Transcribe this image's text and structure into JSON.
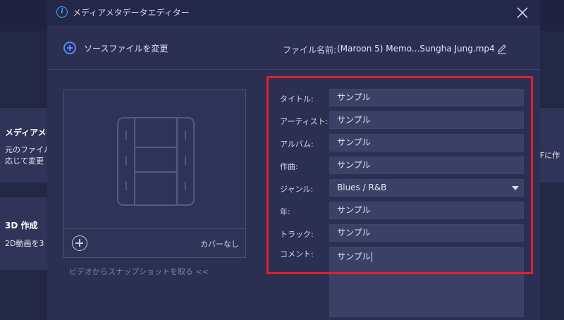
{
  "background": {
    "card1": {
      "title": "メディアメタ",
      "desc": [
        "元のファイル",
        "応じて変更"
      ]
    },
    "card2": {
      "title": "3D 作成",
      "desc": "2D動画を3"
    },
    "right_card": {
      "desc": "GIFに作"
    }
  },
  "dialog": {
    "title": "メディアメタデータエディター",
    "info_icon": "info-icon",
    "close_icon": "close-icon",
    "toolbar": {
      "change_source_label": "ソースファイルを変更",
      "filename_label": "ファイル名前:",
      "filename_value": "(Maroon 5) Memo...Sungha Jung.mp4",
      "edit_icon": "pencil-icon"
    },
    "cover": {
      "no_cover_label": "カバーなし",
      "snapshot_link": "ビデオからスナップショットを取る <<"
    },
    "form": {
      "title": {
        "label": "タイトル:",
        "value": "サンプル"
      },
      "artist": {
        "label": "アーティスト:",
        "value": "サンプル"
      },
      "album": {
        "label": "アルバム:",
        "value": "サンプル"
      },
      "composer": {
        "label": "作曲:",
        "value": "サンプル"
      },
      "genre": {
        "label": "ジャンル:",
        "value": "Blues / R&B"
      },
      "year": {
        "label": "年:",
        "value": "サンプル"
      },
      "track": {
        "label": "トラック:",
        "value": "サンプル"
      },
      "comment": {
        "label": "コメント:",
        "value": "サンプル"
      }
    },
    "highlight_color": "#e02030",
    "accent_color": "#5b86ff"
  }
}
